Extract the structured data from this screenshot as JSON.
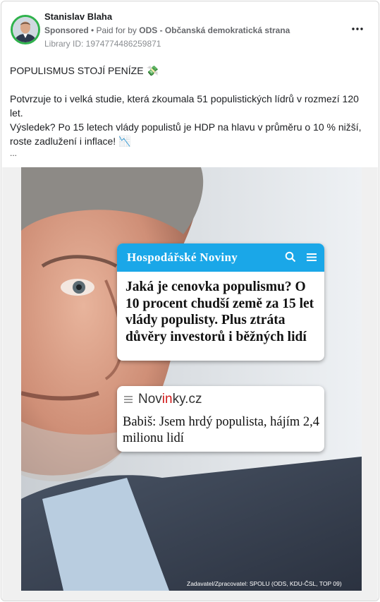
{
  "post": {
    "page_name": "Stanislav Blaha",
    "sponsored": "Sponsored",
    "separator": " • ",
    "paid_for_prefix": "Paid for by ",
    "paid_for_name": "ODS - Občanská demokratická strana",
    "library_id": "Library ID: 1974774486259871",
    "more_icon": "more-horizontal-icon"
  },
  "body": {
    "headline": "POPULISMUS STOJÍ PENÍZE",
    "headline_emoji": "💸",
    "paragraph1": "Potvrzuje to i velká studie, která zkoumala 51 populistických lídrů v rozmezí 120 let.",
    "paragraph2": "Výsledek? Po 15 letech vlády populistů je HDP na hlavu v průměru o 10 % nižší, roste zadlužení i inflace!",
    "paragraph2_emoji": "📉",
    "ellipsis": "..."
  },
  "creative": {
    "hn_brand": "Hospodářské Noviny",
    "hn_headline": "Jaká je cenovka populismu? O 10 procent chudší země za 15 let vlády populisty. Plus ztráta důvěry investorů i běžných lidí",
    "nv_brand_pre": "Nov",
    "nv_brand_hl": "in",
    "nv_brand_post": "ky.cz",
    "nv_headline": "Babiš: Jsem hrdý populista, hájím 2,4 milionu lidí",
    "credit": "Zadavatel/Zpracovatel: SPOLU (ODS, KDU-ČSL, TOP 09)"
  },
  "colors": {
    "hn_blue": "#1aa7e8",
    "avatar_ring": "#2fb24c",
    "novinky_red": "#d11a1a"
  }
}
